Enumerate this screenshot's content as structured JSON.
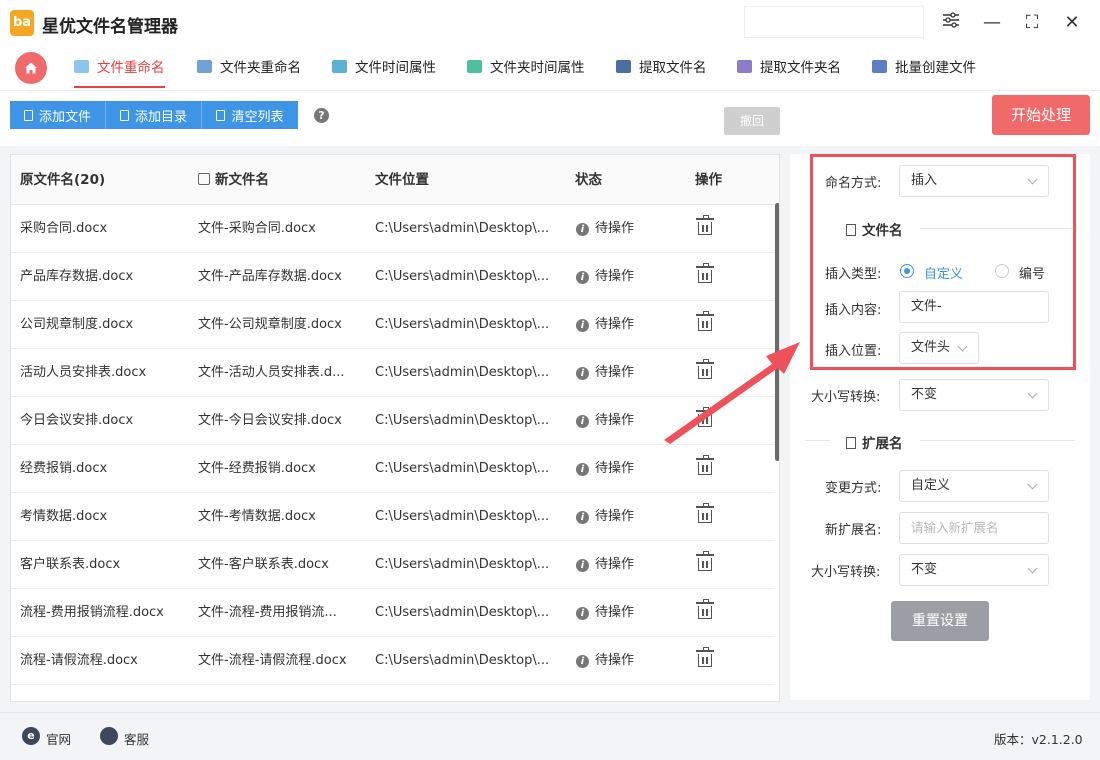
{
  "app": {
    "title": "星优文件名管理器",
    "logo_text": "ba"
  },
  "window": {
    "minimize": "—",
    "maximize": "⛶",
    "close": "✕"
  },
  "tabs": [
    {
      "label": "文件重命名",
      "active": true,
      "color": "#e8413e"
    },
    {
      "label": "文件夹重命名",
      "active": false,
      "color": "#6fa3d8"
    },
    {
      "label": "文件时间属性",
      "active": false,
      "color": "#5bb0d6"
    },
    {
      "label": "文件夹时间属性",
      "active": false,
      "color": "#4fbf9f"
    },
    {
      "label": "提取文件名",
      "active": false,
      "color": "#4a6fa5"
    },
    {
      "label": "提取文件夹名",
      "active": false,
      "color": "#8a7cc9"
    },
    {
      "label": "批量创建文件",
      "active": false,
      "color": "#5c7fc4"
    }
  ],
  "toolbar": {
    "add_file": "添加文件",
    "add_dir": "添加目录",
    "clear_list": "清空列表",
    "help": "?",
    "undo": "撤回",
    "start": "开始处理"
  },
  "table": {
    "columns": {
      "original": "原文件名(20)",
      "new": "新文件名",
      "location": "文件位置",
      "status": "状态",
      "action": "操作"
    },
    "rows": [
      {
        "original": "采购合同.docx",
        "new": "文件-采购合同.docx",
        "location": "C:\\Users\\admin\\Desktop\\...",
        "status": "待操作"
      },
      {
        "original": "产品库存数据.docx",
        "new": "文件-产品库存数据.docx",
        "location": "C:\\Users\\admin\\Desktop\\...",
        "status": "待操作"
      },
      {
        "original": "公司规章制度.docx",
        "new": "文件-公司规章制度.docx",
        "location": "C:\\Users\\admin\\Desktop\\...",
        "status": "待操作"
      },
      {
        "original": "活动人员安排表.docx",
        "new": "文件-活动人员安排表.d...",
        "location": "C:\\Users\\admin\\Desktop\\...",
        "status": "待操作"
      },
      {
        "original": "今日会议安排.docx",
        "new": "文件-今日会议安排.docx",
        "location": "C:\\Users\\admin\\Desktop\\...",
        "status": "待操作"
      },
      {
        "original": "经费报销.docx",
        "new": "文件-经费报销.docx",
        "location": "C:\\Users\\admin\\Desktop\\...",
        "status": "待操作"
      },
      {
        "original": "考情数据.docx",
        "new": "文件-考情数据.docx",
        "location": "C:\\Users\\admin\\Desktop\\...",
        "status": "待操作"
      },
      {
        "original": "客户联系表.docx",
        "new": "文件-客户联系表.docx",
        "location": "C:\\Users\\admin\\Desktop\\...",
        "status": "待操作"
      },
      {
        "original": "流程-费用报销流程.docx",
        "new": "文件-流程-费用报销流...",
        "location": "C:\\Users\\admin\\Desktop\\...",
        "status": "待操作"
      },
      {
        "original": "流程-请假流程.docx",
        "new": "文件-流程-请假流程.docx",
        "location": "C:\\Users\\admin\\Desktop\\...",
        "status": "待操作"
      }
    ]
  },
  "panel": {
    "naming_label": "命名方式:",
    "naming_value": "插入",
    "filename_section": "文件名",
    "insert_type_label": "插入类型:",
    "insert_type_custom": "自定义",
    "insert_type_number": "编号",
    "insert_content_label": "插入内容:",
    "insert_content_value": "文件-",
    "insert_pos_label": "插入位置:",
    "insert_pos_value": "文件头",
    "case_label": "大小写转换:",
    "case_value": "不变",
    "ext_section": "扩展名",
    "change_label": "变更方式:",
    "change_value": "自定义",
    "new_ext_label": "新扩展名:",
    "new_ext_placeholder": "请输入新扩展名",
    "ext_case_label": "大小写转换:",
    "ext_case_value": "不变",
    "reset": "重置设置"
  },
  "statusbar": {
    "website": "官网",
    "website_icon": "e",
    "support": "客服",
    "version": "版本：v2.1.2.0"
  },
  "colors": {
    "accent_red": "#f06a6a",
    "accent_blue": "#3e95e6",
    "highlight_box": "#f0505a"
  }
}
